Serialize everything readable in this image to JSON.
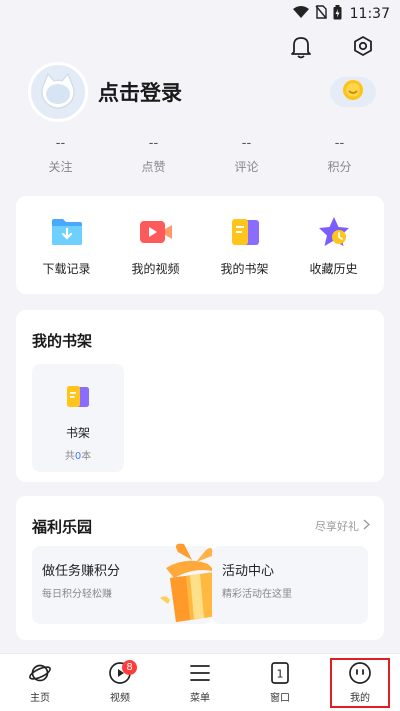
{
  "status_bar": {
    "time": "11:37"
  },
  "profile": {
    "login_label": "点击登录"
  },
  "stats": [
    {
      "value": "--",
      "label": "关注"
    },
    {
      "value": "--",
      "label": "点赞"
    },
    {
      "value": "--",
      "label": "评论"
    },
    {
      "value": "--",
      "label": "积分"
    }
  ],
  "quick_actions": [
    {
      "label": "下载记录",
      "icon": "download-folder-icon"
    },
    {
      "label": "我的视频",
      "icon": "video-icon"
    },
    {
      "label": "我的书架",
      "icon": "bookshelf-icon"
    },
    {
      "label": "收藏历史",
      "icon": "star-history-icon"
    }
  ],
  "shelf": {
    "title": "我的书架",
    "tile_label": "书架",
    "count_prefix": "共",
    "count": "0",
    "count_suffix": "本"
  },
  "welfare": {
    "title": "福利乐园",
    "more": "尽享好礼",
    "left_title": "做任务赚积分",
    "left_sub": "每日积分轻松赚",
    "right_title": "活动中心",
    "right_sub": "精彩活动在这里"
  },
  "tabbar": [
    {
      "label": "主页",
      "icon": "planet-icon"
    },
    {
      "label": "视频",
      "icon": "play-icon",
      "badge": "8"
    },
    {
      "label": "菜单",
      "icon": "menu-icon"
    },
    {
      "label": "窗口",
      "icon": "window-icon",
      "window_count": "1"
    },
    {
      "label": "我的",
      "icon": "face-icon"
    }
  ],
  "colors": {
    "accent": "#3a7bff",
    "badge": "#ff3b3b",
    "highlight_box": "#e02020"
  }
}
